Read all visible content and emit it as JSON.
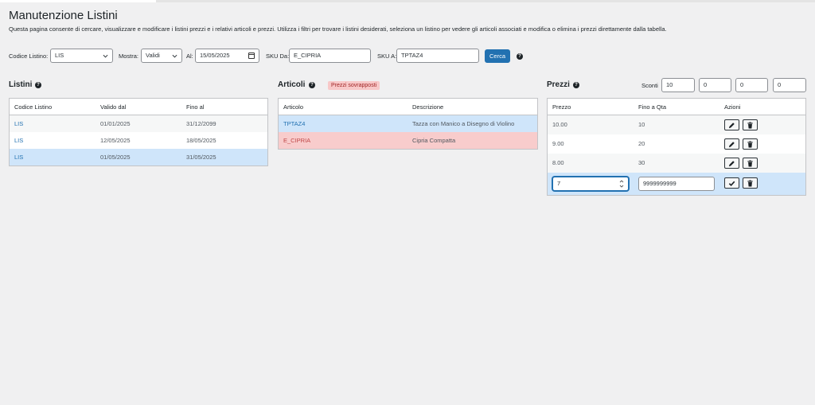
{
  "page": {
    "title": "Manutenzione Listini",
    "description": "Questa pagina consente di cercare, visualizzare e modificare i listini prezzi e i relativi articoli e prezzi. Utilizza i filtri per trovare i listini desiderati, seleziona un listino per vedere gli articoli associati e modifica o elimina i prezzi direttamente dalla tabella."
  },
  "filters": {
    "codice_label": "Codice Listino:",
    "codice_value": "LIS",
    "mostra_label": "Mostra:",
    "mostra_value": "Validi",
    "al_label": "Al:",
    "al_value": "15/05/2025",
    "sku_da_label": "SKU Da:",
    "sku_da_value": "E_CIPRIA",
    "sku_a_label": "SKU A:",
    "sku_a_value": "TPTAZ4",
    "search_label": "Cerca"
  },
  "listini": {
    "title": "Listini",
    "columns": [
      "Codice Listino",
      "Valido dal",
      "Fino al"
    ],
    "rows": [
      {
        "codice": "LIS",
        "dal": "01/01/2025",
        "al": "31/12/2099"
      },
      {
        "codice": "LIS",
        "dal": "12/05/2025",
        "al": "18/05/2025"
      },
      {
        "codice": "LIS",
        "dal": "01/05/2025",
        "al": "31/05/2025"
      }
    ]
  },
  "articoli": {
    "title": "Articoli",
    "badge": "Prezzi sovrapposti",
    "columns": [
      "Articolo",
      "Descrizione"
    ],
    "rows": [
      {
        "articolo": "TPTAZ4",
        "descrizione": "Tazza con Manico a Disegno di Violino"
      },
      {
        "articolo": "E_CIPRIA",
        "descrizione": "Cipria Compatta"
      }
    ]
  },
  "prezzi": {
    "title": "Prezzi",
    "sconti_label": "Sconti",
    "sconti": [
      "10",
      "0",
      "0",
      "0"
    ],
    "columns": [
      "Prezzo",
      "Fino a Qta",
      "Azioni"
    ],
    "rows": [
      {
        "prezzo": "10.00",
        "qta": "10"
      },
      {
        "prezzo": "9.00",
        "qta": "20"
      },
      {
        "prezzo": "8.00",
        "qta": "30"
      }
    ],
    "edit_row": {
      "prezzo": "7",
      "qta": "9999999999"
    }
  },
  "colors": {
    "accent": "#2271b1",
    "selected_row": "#cfe5fa",
    "conflict_row": "#f8cccc",
    "badge_bg": "#f8c8c8"
  },
  "icons": [
    "help-icon",
    "chevron-down-icon",
    "calendar-icon",
    "pencil-icon",
    "trash-icon",
    "check-icon",
    "spinner-arrows-icon"
  ]
}
